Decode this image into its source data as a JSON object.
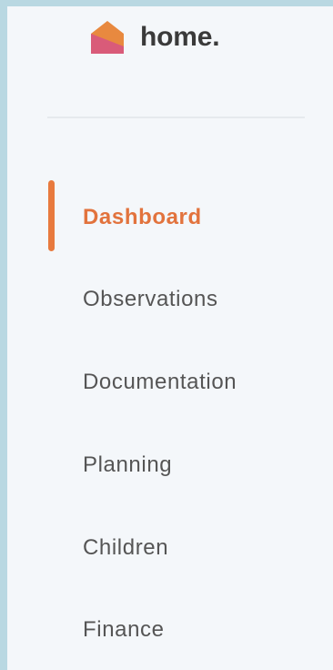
{
  "brand": {
    "name": "home.",
    "icon": "house-logo-icon",
    "colors": {
      "roof": "#e8893f",
      "body": "#d95b79"
    }
  },
  "nav": {
    "items": [
      {
        "label": "Dashboard",
        "active": true
      },
      {
        "label": "Observations",
        "active": false
      },
      {
        "label": "Documentation",
        "active": false
      },
      {
        "label": "Planning",
        "active": false
      },
      {
        "label": "Children",
        "active": false
      },
      {
        "label": "Finance",
        "active": false
      }
    ],
    "active_color": "#e2733d",
    "text_color": "#555555"
  }
}
